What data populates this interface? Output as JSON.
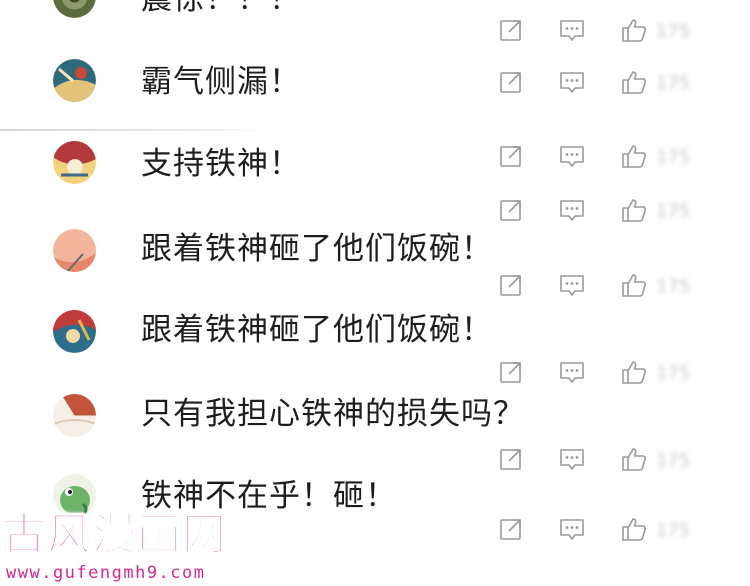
{
  "comments": [
    {
      "text": "震惊！！！",
      "likes": "175",
      "avatar_colors": [
        "#5c6b3d",
        "#8e9a6a"
      ]
    },
    {
      "text": "霸气侧漏！",
      "likes": "175",
      "avatar_colors": [
        "#2e6b7a",
        "#e3c27a"
      ]
    },
    {
      "text": "支持铁神！",
      "likes": "175",
      "avatar_colors": [
        "#b23a3a",
        "#f2d27a"
      ]
    },
    {
      "text": "跟着铁神砸了他们饭碗！",
      "likes": "175",
      "avatar_colors": [
        "#f2b59a",
        "#e9866a"
      ]
    },
    {
      "text": "跟着铁神砸了他们饭碗！",
      "likes": "175",
      "avatar_colors": [
        "#c23b3b",
        "#2c6f8a"
      ]
    },
    {
      "text": "只有我担心铁神的损失吗？",
      "likes": "175",
      "avatar_colors": [
        "#f6efe6",
        "#c4553a"
      ]
    },
    {
      "text": "铁神不在乎！砸！",
      "likes": "175",
      "avatar_colors": [
        "#6db36a",
        "#3e7d3c"
      ]
    }
  ],
  "extra_action_rows": [
    {
      "likes": "175"
    },
    {
      "likes": "175"
    }
  ],
  "icons": {
    "share": "share-icon",
    "reply": "reply-icon",
    "like": "thumbs-up-icon"
  },
  "watermark": {
    "name": "古风漫画网",
    "url": "www.gufengmh9.com",
    "color": "#ee2a9b"
  }
}
